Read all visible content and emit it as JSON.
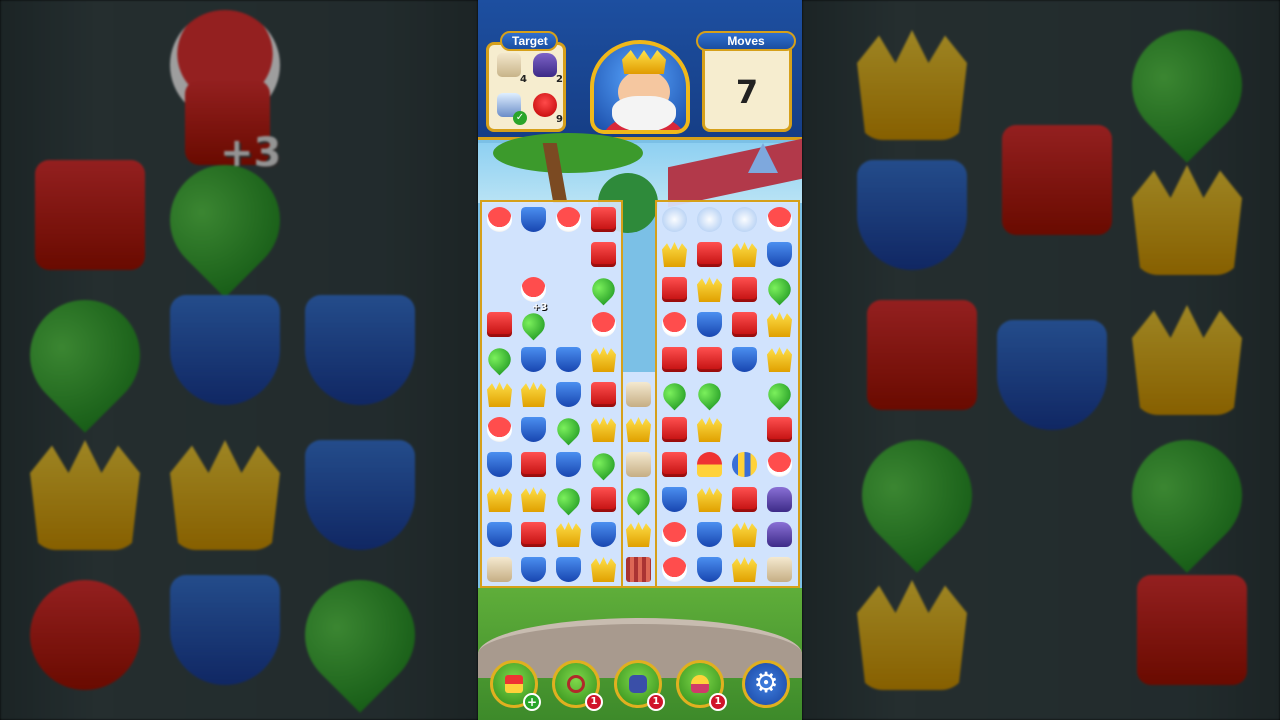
{
  "hud": {
    "target_label": "Target",
    "moves_label": "Moves",
    "moves_value": "7",
    "goals": [
      {
        "icon": "sandbag-icon",
        "count": "4"
      },
      {
        "icon": "vase-icon",
        "count": "2"
      },
      {
        "icon": "jar-icon",
        "count": "",
        "completed": true
      },
      {
        "icon": "red-bird-icon",
        "count": "9"
      }
    ]
  },
  "board": {
    "floating_bonus": "+3",
    "pieces": [
      [
        "bird",
        "blue",
        "bird",
        "red",
        "gap",
        "ice",
        "ice",
        "ice",
        "bird"
      ],
      [
        "",
        "",
        "",
        "red",
        "gap",
        "yellow",
        "red",
        "yellow",
        "blue"
      ],
      [
        "",
        "bird",
        "",
        "green",
        "gap",
        "red",
        "yellow",
        "red",
        "green"
      ],
      [
        "red",
        "green",
        "",
        "bird",
        "gap",
        "bird",
        "blue",
        "red",
        "yellow"
      ],
      [
        "green",
        "blue",
        "blue",
        "yellow",
        "gap",
        "red",
        "red",
        "blue",
        "yellow"
      ],
      [
        "yellow",
        "yellow",
        "blue",
        "red",
        "bag",
        "green",
        "green",
        "",
        "green"
      ],
      [
        "bird",
        "blue",
        "green",
        "yellow",
        "yellow",
        "red",
        "yellow",
        "",
        "red"
      ],
      [
        "blue",
        "red",
        "blue",
        "green",
        "bag",
        "red",
        "jester",
        "rocket",
        "bird"
      ],
      [
        "yellow",
        "yellow",
        "green",
        "red",
        "green",
        "blue",
        "yellow",
        "red",
        "vase"
      ],
      [
        "blue",
        "red",
        "yellow",
        "blue",
        "yellow",
        "bird",
        "blue",
        "yellow",
        "vase"
      ],
      [
        "bag",
        "blue",
        "blue",
        "yellow",
        "crate",
        "bird",
        "blue",
        "yellow",
        "bag"
      ]
    ]
  },
  "boosters": [
    {
      "name": "hammer-booster",
      "badge": "+",
      "type": "plus"
    },
    {
      "name": "bow-booster",
      "badge": "1",
      "type": "count"
    },
    {
      "name": "cannon-booster",
      "badge": "1",
      "type": "count"
    },
    {
      "name": "jester-booster",
      "badge": "1",
      "type": "count"
    }
  ],
  "settings_icon": "gear-icon",
  "background": {
    "bonus_text": "+3"
  },
  "colors": {
    "hud_blue": "#1d4fa0",
    "gold": "#d6a01a",
    "badge_red": "#d0142a"
  }
}
